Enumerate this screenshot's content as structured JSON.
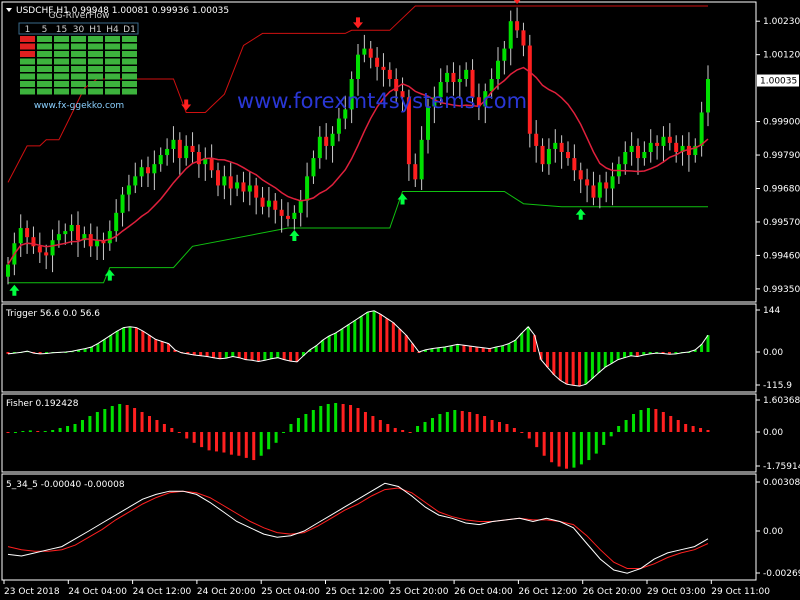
{
  "symbol_header": "USDCHF,H1  0.99948 1.00081 0.99936 1.00035",
  "watermark": "www.forexmt4systems.com",
  "widget": {
    "title": "GG-RiverFlow",
    "timeframes": [
      "1",
      "5",
      "15",
      "30",
      "H1",
      "H4",
      "D1"
    ],
    "url": "www.fx-ggekko.com",
    "colors": {
      "green": "#3db33d",
      "red": "#e02020"
    }
  },
  "price_panel": {
    "ticks": [
      "1.00230",
      "1.00120",
      "0.99900",
      "0.99790",
      "0.99680",
      "0.99570",
      "0.99460",
      "0.99350"
    ],
    "current_price": "1.00035",
    "ylim": [
      0.9932,
      1.0028
    ]
  },
  "trigger_panel": {
    "title": "Trigger 56.6 0.0 56.6",
    "ticks": [
      "144",
      "0.00",
      "-115.9"
    ]
  },
  "fisher_panel": {
    "title": "Fisher 0.192428",
    "ticks": [
      "1.603682",
      "0.00",
      "-1.759142"
    ]
  },
  "macd_panel": {
    "title": "5_34_5 -0.00040 -0.00008",
    "ticks": [
      "0.00308",
      "0.00",
      "-0.00269"
    ]
  },
  "time_axis": [
    "23 Oct 2018",
    "24 Oct 04:00",
    "24 Oct 12:00",
    "24 Oct 20:00",
    "25 Oct 04:00",
    "25 Oct 12:00",
    "25 Oct 20:00",
    "26 Oct 04:00",
    "26 Oct 12:00",
    "26 Oct 20:00",
    "29 Oct 03:00",
    "29 Oct 11:00"
  ],
  "colors": {
    "bull": "#00e000",
    "bear": "#ff2020",
    "ma": "#e0203c",
    "upper_band": "#d01010",
    "lower_band": "#10c010",
    "up_arrow": "#00ff40",
    "down_arrow": "#ff2020",
    "macd_main": "#ffffff",
    "macd_signal": "#ff2020"
  },
  "chart_data": {
    "type": "candlestick",
    "closes": [
      0.9943,
      0.995,
      0.9955,
      0.9952,
      0.9949,
      0.9947,
      0.9946,
      0.9951,
      0.9953,
      0.9954,
      0.9956,
      0.9951,
      0.9953,
      0.9949,
      0.9951,
      0.995,
      0.9954,
      0.996,
      0.9966,
      0.9969,
      0.9972,
      0.9975,
      0.9973,
      0.9976,
      0.9979,
      0.9981,
      0.9984,
      0.9978,
      0.9982,
      0.998,
      0.9976,
      0.9978,
      0.9974,
      0.9969,
      0.9972,
      0.9968,
      0.997,
      0.9967,
      0.9969,
      0.9965,
      0.9962,
      0.9964,
      0.9961,
      0.9959,
      0.9958,
      0.996,
      0.9964,
      0.9972,
      0.9978,
      0.9985,
      0.9982,
      0.9986,
      0.9991,
      0.9994,
      1.0004,
      1.0012,
      1.0014,
      1.0011,
      1.0008,
      1.0007,
      1.0004,
      1.0,
      0.9998,
      0.9976,
      0.9971,
      0.9984,
      0.9995,
      0.9998,
      1.0003,
      1.0006,
      1.0003,
      1.0004,
      1.0007,
      0.9998,
      0.9995,
      1.0,
      1.0004,
      1.001,
      1.0014,
      1.0023,
      1.002,
      1.0015,
      0.9986,
      0.9982,
      0.9976,
      0.9981,
      0.9983,
      0.998,
      0.9978,
      0.9974,
      0.9971,
      0.9969,
      0.9965,
      0.997,
      0.9968,
      0.9972,
      0.9976,
      0.998,
      0.9982,
      0.9978,
      0.998,
      0.9983,
      0.9982,
      0.9985,
      0.9983,
      0.998,
      0.9982,
      0.9979,
      0.9982,
      0.9993,
      1.0004
    ],
    "ma_period": 12,
    "upper_band": [
      [
        0,
        0.997
      ],
      [
        3,
        0.9982
      ],
      [
        5,
        0.9982
      ],
      [
        6,
        0.9984
      ],
      [
        8,
        0.9984
      ],
      [
        12,
        1.0001
      ],
      [
        14,
        1.0004
      ],
      [
        26,
        1.0004
      ],
      [
        28,
        0.9993
      ],
      [
        31,
        0.9993
      ],
      [
        32,
        0.9995
      ],
      [
        34,
        0.9999
      ],
      [
        37,
        1.0015
      ],
      [
        40,
        1.0019
      ],
      [
        53,
        1.0019
      ],
      [
        54,
        1.002
      ],
      [
        58,
        1.002
      ],
      [
        60,
        1.002
      ],
      [
        62,
        1.0024
      ],
      [
        64,
        1.0028
      ],
      [
        110,
        1.0028
      ]
    ],
    "lower_band": [
      [
        0,
        0.9937
      ],
      [
        15,
        0.9937
      ],
      [
        16,
        0.9942
      ],
      [
        26,
        0.9942
      ],
      [
        29,
        0.9949
      ],
      [
        44,
        0.9955
      ],
      [
        60,
        0.9955
      ],
      [
        62,
        0.9967
      ],
      [
        78,
        0.9967
      ],
      [
        81,
        0.9963
      ],
      [
        87,
        0.9962
      ],
      [
        110,
        0.9962
      ]
    ],
    "up_arrows": [
      1,
      16,
      45,
      62,
      90
    ],
    "down_arrows": [
      28,
      55,
      80
    ],
    "trigger": [
      -5,
      -3,
      -1,
      2,
      -3,
      -5,
      -4,
      -2,
      -1,
      0,
      2,
      5,
      8,
      12,
      20,
      30,
      40,
      50,
      58,
      60,
      58,
      50,
      40,
      30,
      25,
      20,
      5,
      -2,
      -5,
      -8,
      -10,
      -12,
      -15,
      -18,
      -16,
      -12,
      -15,
      -20,
      -22,
      -25,
      -22,
      -18,
      -15,
      -20,
      -24,
      -26,
      -10,
      5,
      15,
      28,
      38,
      45,
      55,
      65,
      75,
      85,
      95,
      98,
      90,
      80,
      70,
      55,
      40,
      20,
      0,
      5,
      8,
      10,
      12,
      15,
      18,
      16,
      14,
      12,
      10,
      8,
      12,
      15,
      20,
      28,
      45,
      60,
      40,
      -20,
      -40,
      -60,
      -75,
      -85,
      -88,
      -90,
      -85,
      -70,
      -55,
      -40,
      -30,
      -20,
      -15,
      -10,
      -12,
      -8,
      -5,
      -3,
      -4,
      -6,
      -5,
      -2,
      0,
      5,
      18,
      40
    ],
    "fisher": [
      0.0,
      0.0,
      0.05,
      0.08,
      0.05,
      0.05,
      0.1,
      0.2,
      0.3,
      0.4,
      0.6,
      0.8,
      1.0,
      1.15,
      1.3,
      1.4,
      1.35,
      1.2,
      1.0,
      0.8,
      0.6,
      0.4,
      0.2,
      0.0,
      -0.3,
      -0.5,
      -0.7,
      -0.85,
      -0.9,
      -0.95,
      -1.05,
      -1.1,
      -1.2,
      -1.3,
      -1.1,
      -0.8,
      -0.5,
      0.0,
      0.4,
      0.7,
      0.9,
      1.1,
      1.3,
      1.4,
      1.45,
      1.4,
      1.35,
      1.2,
      1.0,
      0.8,
      0.6,
      0.4,
      0.2,
      0.1,
      0.0,
      0.3,
      0.5,
      0.7,
      0.9,
      1.0,
      1.1,
      1.05,
      1.0,
      0.9,
      0.8,
      0.6,
      0.5,
      0.4,
      0.2,
      0.0,
      -0.3,
      -0.7,
      -1.1,
      -1.4,
      -1.6,
      -1.7,
      -1.65,
      -1.5,
      -1.3,
      -1.0,
      -0.6,
      -0.2,
      0.3,
      0.6,
      0.9,
      1.1,
      1.2,
      1.15,
      1.0,
      0.8,
      0.6,
      0.4,
      0.3,
      0.2,
      0.1
    ],
    "macd_main": [
      -0.0015,
      -0.0016,
      -0.0014,
      -0.0012,
      -0.001,
      -0.0005,
      0.0,
      0.0005,
      0.001,
      0.0015,
      0.002,
      0.0023,
      0.0025,
      0.0025,
      0.0023,
      0.0018,
      0.0012,
      0.0006,
      0.0002,
      -0.0002,
      -0.0004,
      -0.0003,
      0.0,
      0.0005,
      0.001,
      0.0015,
      0.002,
      0.0025,
      0.003,
      0.0028,
      0.0022,
      0.0015,
      0.001,
      0.0008,
      0.0005,
      0.0004,
      0.0006,
      0.0007,
      0.0008,
      0.0006,
      0.0008,
      0.0006,
      0.0002,
      -0.0008,
      -0.0018,
      -0.0025,
      -0.0027,
      -0.0024,
      -0.0018,
      -0.0014,
      -0.0012,
      -0.001,
      -0.0005
    ],
    "macd_signal": [
      -0.001,
      -0.0012,
      -0.0013,
      -0.0013,
      -0.0012,
      -0.0009,
      -0.0004,
      0.0001,
      0.0007,
      0.0012,
      0.0017,
      0.0021,
      0.0024,
      0.0025,
      0.0024,
      0.0021,
      0.0016,
      0.0011,
      0.0006,
      0.0002,
      -0.0001,
      -0.0002,
      -0.0001,
      0.0003,
      0.0008,
      0.0013,
      0.0017,
      0.0022,
      0.0026,
      0.0027,
      0.0024,
      0.0018,
      0.0012,
      0.0009,
      0.0007,
      0.0006,
      0.0006,
      0.0007,
      0.0008,
      0.0007,
      0.0007,
      0.0006,
      0.0004,
      -0.0003,
      -0.0012,
      -0.002,
      -0.0024,
      -0.0024,
      -0.0021,
      -0.0017,
      -0.0014,
      -0.0012,
      -0.0008
    ]
  }
}
